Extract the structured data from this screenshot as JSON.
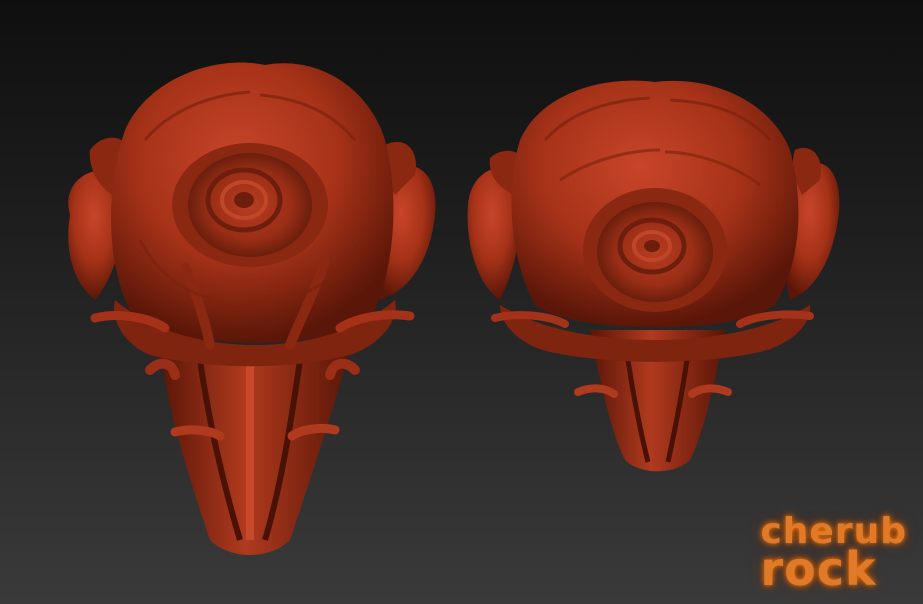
{
  "scene": {
    "description_colors": {
      "background_top": "#0f0f0f",
      "background_bottom": "#3a3a3a",
      "sculpt_base": "#a53218",
      "sculpt_shadow": "#5a1608",
      "sculpt_highlight": "#c8452a"
    }
  },
  "watermark": {
    "line1": "cherub",
    "line2": "rock",
    "color": "#e07a28"
  }
}
